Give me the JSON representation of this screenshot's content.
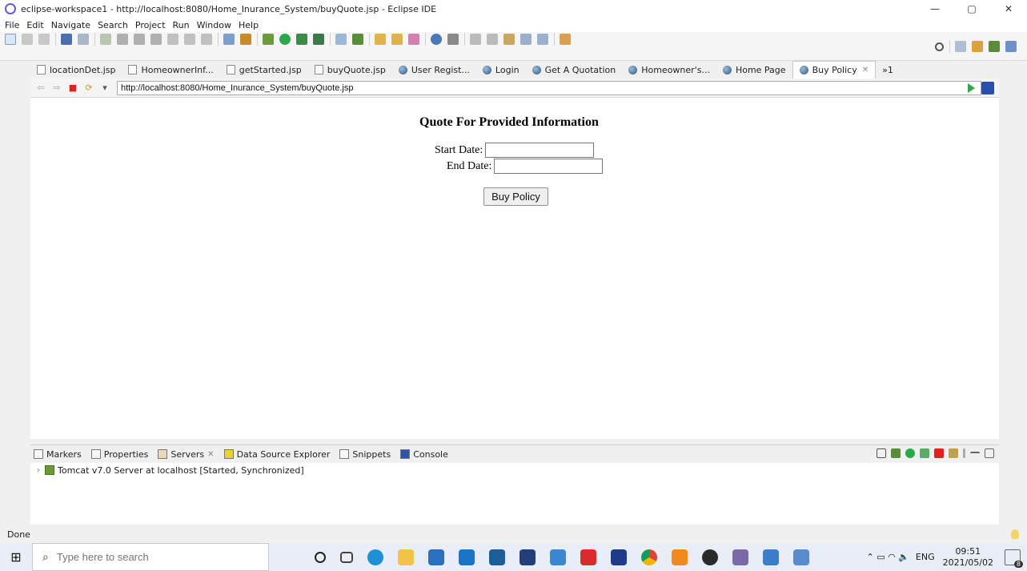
{
  "window": {
    "title": "eclipse-workspace1 - http://localhost:8080/Home_Inurance_System/buyQuote.jsp - Eclipse IDE",
    "minimize": "—",
    "maximize": "▢",
    "close": "✕"
  },
  "menu": [
    "File",
    "Edit",
    "Navigate",
    "Search",
    "Project",
    "Run",
    "Window",
    "Help"
  ],
  "editor_tabs": [
    {
      "label": "locationDet.jsp",
      "type": "file"
    },
    {
      "label": "HomeownerInf...",
      "type": "file"
    },
    {
      "label": "getStarted.jsp",
      "type": "file"
    },
    {
      "label": "buyQuote.jsp",
      "type": "file"
    },
    {
      "label": "User Regist...",
      "type": "web"
    },
    {
      "label": "Login",
      "type": "web"
    },
    {
      "label": "Get A Quotation",
      "type": "web"
    },
    {
      "label": "Homeowner's...",
      "type": "web"
    },
    {
      "label": "Home Page",
      "type": "web"
    },
    {
      "label": "Buy Policy",
      "type": "web",
      "active": true
    }
  ],
  "tabs_overflow": "»1",
  "browser": {
    "url": "http://localhost:8080/Home_Inurance_System/buyQuote.jsp"
  },
  "page": {
    "heading": "Quote For Provided Information",
    "start_label": "Start Date:",
    "end_label": "End Date:",
    "start_value": "",
    "end_value": "",
    "buy_button": "Buy Policy"
  },
  "bottom_panel": {
    "tabs": [
      "Markers",
      "Properties",
      "Servers",
      "Data Source Explorer",
      "Snippets",
      "Console"
    ],
    "server": "Tomcat v7.0 Server at localhost  [Started, Synchronized]"
  },
  "status": "Done",
  "taskbar": {
    "search_placeholder": "Type here to search",
    "lang": "ENG",
    "time": "09:51",
    "date": "2021/05/02",
    "notifications": "8"
  }
}
